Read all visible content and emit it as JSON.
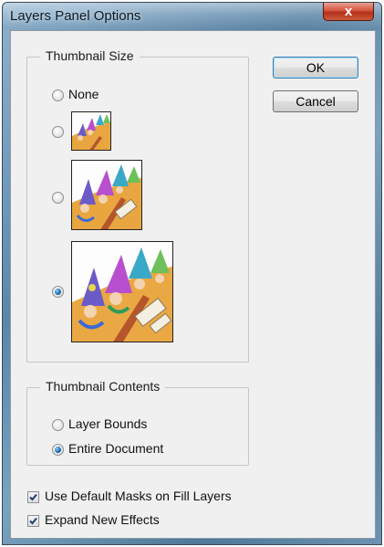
{
  "window": {
    "title": "Layers Panel Options",
    "close_label": "x"
  },
  "buttons": {
    "ok": "OK",
    "cancel": "Cancel"
  },
  "thumbnail_size": {
    "legend": "Thumbnail Size",
    "options": [
      {
        "label": "None",
        "selected": false
      },
      {
        "label": "",
        "selected": false
      },
      {
        "label": "",
        "selected": false
      },
      {
        "label": "",
        "selected": true
      }
    ]
  },
  "thumbnail_contents": {
    "legend": "Thumbnail Contents",
    "options": [
      {
        "label": "Layer Bounds",
        "selected": false
      },
      {
        "label": "Entire Document",
        "selected": true
      }
    ]
  },
  "checkboxes": [
    {
      "label": "Use Default Masks on Fill Layers",
      "checked": true
    },
    {
      "label": "Expand New Effects",
      "checked": true
    }
  ],
  "colors": {
    "accent": "#1f6fb5",
    "dialog_bg": "#f0f0f0",
    "close_red": "#c9452c"
  }
}
